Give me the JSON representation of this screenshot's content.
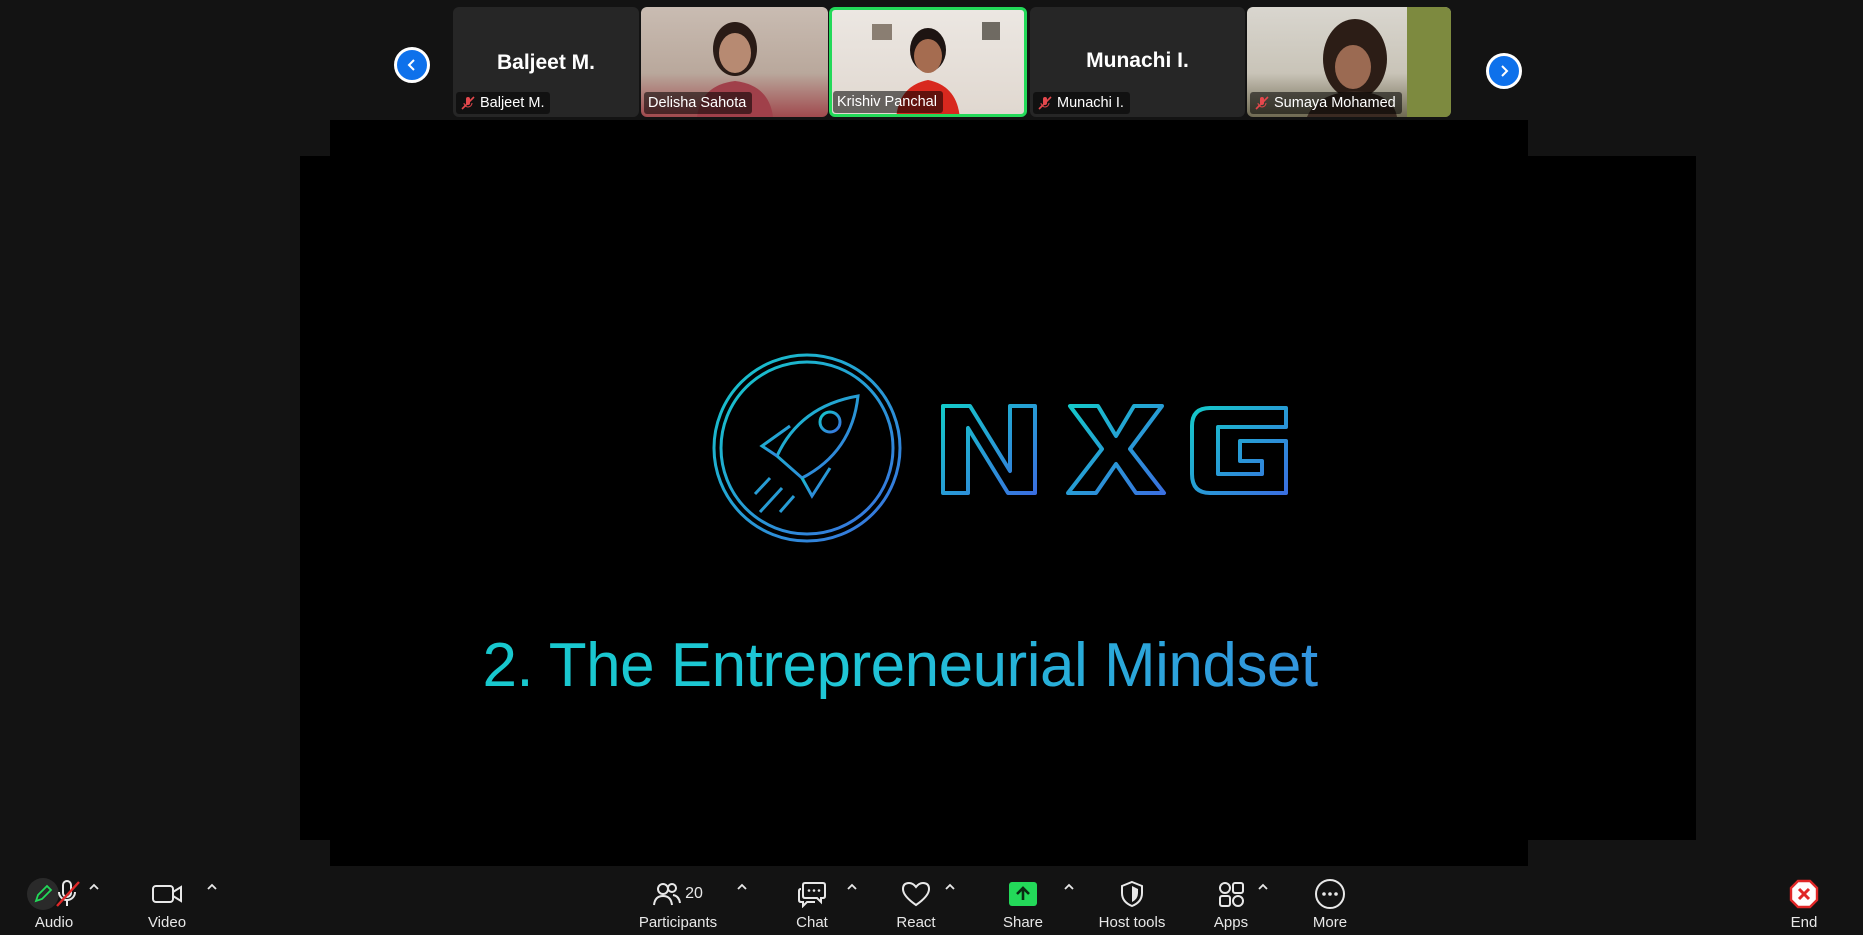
{
  "gallery": {
    "participants": [
      {
        "name_large": "Baljeet M.",
        "label": "Baljeet M.",
        "muted": true,
        "video": false
      },
      {
        "name_large": "",
        "label": "Delisha Sahota",
        "muted": false,
        "video": true
      },
      {
        "name_large": "",
        "label": "Krishiv Panchal",
        "muted": false,
        "video": true,
        "active_speaker": true
      },
      {
        "name_large": "Munachi I.",
        "label": "Munachi I.",
        "muted": true,
        "video": false
      },
      {
        "name_large": "",
        "label": "Sumaya Mohamed",
        "muted": true,
        "video": true
      }
    ],
    "prev_icon": "chevron-left-icon",
    "next_icon": "chevron-right-icon"
  },
  "slide": {
    "logo_text": "NXG",
    "title": "2. The Entrepreneurial Mindset",
    "colors": {
      "teal": "#14c9c9",
      "blue": "#3a7fe0"
    }
  },
  "toolbar": {
    "audio": "Audio",
    "video": "Video",
    "participants": "Participants",
    "participants_count": "20",
    "chat": "Chat",
    "react": "React",
    "share": "Share",
    "host_tools": "Host tools",
    "apps": "Apps",
    "more": "More",
    "end": "End",
    "share_color": "#23d959",
    "end_color": "#e02828"
  }
}
